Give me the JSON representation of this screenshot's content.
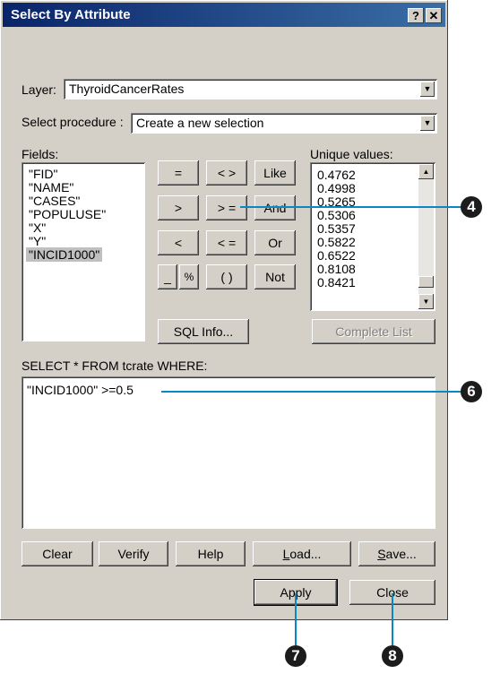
{
  "window": {
    "title": "Select By Attribute",
    "help_button": "?",
    "close_button": "✕"
  },
  "layer": {
    "label": "Layer:",
    "value": "ThyroidCancerRates"
  },
  "procedure": {
    "label": "Select procedure :",
    "value": "Create a new selection"
  },
  "fields": {
    "label": "Fields:",
    "items": [
      "\"FID\"",
      "\"NAME\"",
      "\"CASES\"",
      "\"POPULUSE\"",
      "\"X\"",
      "\"Y\"",
      "\"INCID1000\""
    ],
    "selected_index": 6
  },
  "operators": {
    "eq": "=",
    "ne": "< >",
    "like": "Like",
    "gt": ">",
    "ge": "> =",
    "and": "And",
    "lt": "<",
    "le": "< =",
    "or": "Or",
    "underscore": "_",
    "percent": "%",
    "parens": "( )",
    "not": "Not"
  },
  "unique_values": {
    "label": "Unique values:",
    "items": [
      "0.4762",
      "0.4998",
      "0.5265",
      "0.5306",
      "0.5357",
      "0.5822",
      "0.6522",
      "0.8108",
      "0.8421"
    ]
  },
  "sql_info_label": "SQL Info...",
  "complete_list_label": "Complete List",
  "query": {
    "label": "SELECT * FROM tcrate WHERE:",
    "value": "\"INCID1000\" >=0.5"
  },
  "buttons": {
    "clear": "Clear",
    "verify": "Verify",
    "help": "Help",
    "load_u": "L",
    "load_rest": "oad...",
    "save_u": "S",
    "save_rest": "ave...",
    "apply": "Apply",
    "close": "Close"
  },
  "callouts": {
    "step4": "4",
    "step6": "6",
    "step7": "7",
    "step8": "8"
  },
  "colors": {
    "callout_line": "#0b87c4",
    "badge": "#1c1c1c",
    "titlebar": "#0a246a"
  }
}
